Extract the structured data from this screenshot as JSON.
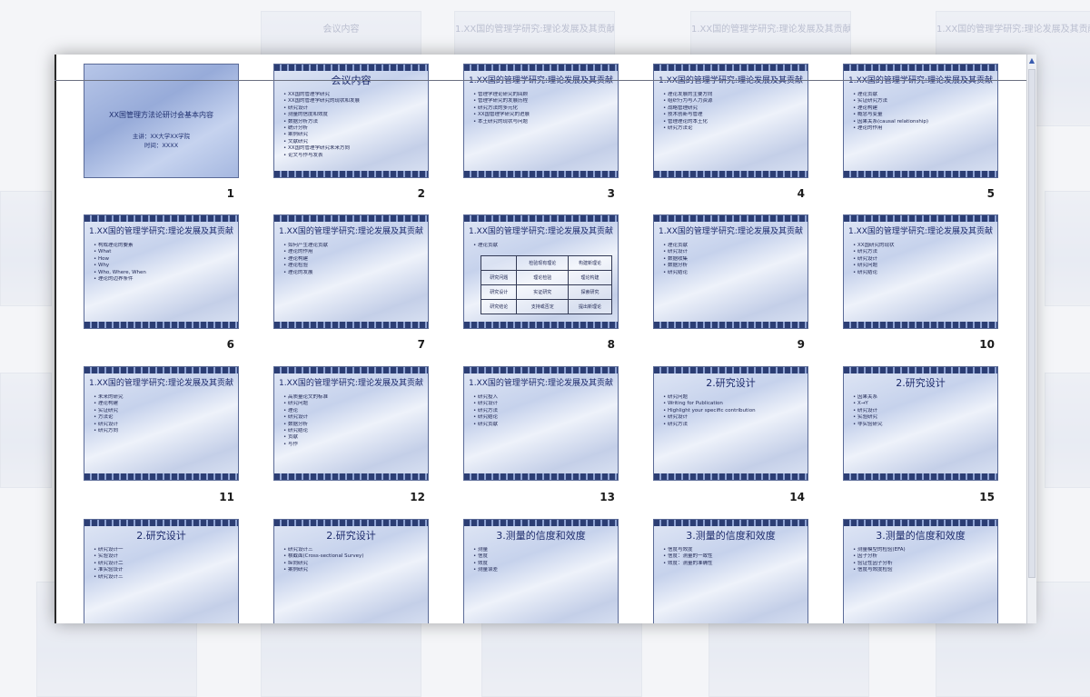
{
  "background_thumbs": [
    {
      "title": "会议内容"
    },
    {
      "title": "1.XX国的管理学研究:理论发展及其贡献"
    },
    {
      "title": "1.XX国的管理学研究:理论发展及其贡献"
    },
    {
      "title": "1.XX国的管理学研究:理论发展及其贡献"
    }
  ],
  "slides": [
    {
      "num": "1",
      "title": "XX国管理方法论研讨会基本内容",
      "cover": true,
      "sub": [
        "主讲：XX大学XX学院",
        "时间：XXXX"
      ],
      "bullets": []
    },
    {
      "num": "2",
      "title": "会议内容",
      "bullets": [
        "XX国的管理学研究",
        "XX国的管理学研究的现状和发展",
        "研究设计",
        "测量的信度和效度",
        "数据分析方法",
        "统计分析",
        "案例研究",
        "文献研究",
        "XX国的管理学研究未来方向",
        "论文写作与发表"
      ]
    },
    {
      "num": "3",
      "title": "1.XX国的管理学研究:理论发展及其贡献",
      "bullets": [
        "管理学理论研究的回顾",
        "管理学研究的发展历程",
        "研究方法的多元化",
        "XX国管理学研究的进展",
        "本土研究的现状与问题"
      ]
    },
    {
      "num": "4",
      "title": "1.XX国的管理学研究:理论发展及其贡献",
      "bullets": [
        "理论发展的主要方向",
        "组织行为与人力资源",
        "战略管理研究",
        "技术创新与管理",
        "管理理论的本土化",
        "研究方法论"
      ]
    },
    {
      "num": "5",
      "title": "1.XX国的管理学研究:理论发展及其贡献",
      "bullets": [
        "理论贡献",
        "实证研究方法",
        "理论构建",
        "概念与变量",
        "因果关系(causal relationship)",
        "理论的作用"
      ]
    },
    {
      "num": "6",
      "title": "1.XX国的管理学研究:理论发展及其贡献",
      "bullets": [
        "构成理论的要素",
        "What",
        "How",
        "Why",
        "Who, Where, When",
        "理论的边界条件"
      ]
    },
    {
      "num": "7",
      "title": "1.XX国的管理学研究:理论发展及其贡献",
      "bullets": [
        "如何产生理论贡献",
        "理论的作用",
        "理论构建",
        "理论检验",
        "理论的发展"
      ]
    },
    {
      "num": "8",
      "title": "1.XX国的管理学研究:理论发展及其贡献",
      "bullets": [
        "理论贡献"
      ],
      "table": [
        [
          "",
          "检验现有理论",
          "构建新理论"
        ],
        [
          "研究问题",
          "理论检验",
          "理论构建"
        ],
        [
          "研究设计",
          "实证研究",
          "探索研究"
        ],
        [
          "研究结论",
          "支持或否定",
          "提出新理论"
        ]
      ]
    },
    {
      "num": "9",
      "title": "1.XX国的管理学研究:理论发展及其贡献",
      "bullets": [
        "理论贡献",
        "研究设计",
        "数据收集",
        "数据分析",
        "研究结论"
      ]
    },
    {
      "num": "10",
      "title": "1.XX国的管理学研究:理论发展及其贡献",
      "bullets": [
        "XX国研究的现状",
        "研究方法",
        "研究设计",
        "研究问题",
        "研究结论"
      ]
    },
    {
      "num": "11",
      "title": "1.XX国的管理学研究:理论发展及其贡献",
      "bullets": [
        "未来的研究",
        "理论构建",
        "实证研究",
        "方法论",
        "研究设计",
        "研究方向"
      ]
    },
    {
      "num": "12",
      "title": "1.XX国的管理学研究:理论发展及其贡献",
      "bullets": [
        "高质量论文的标准",
        "研究问题",
        "理论",
        "研究设计",
        "数据分析",
        "研究结论",
        "贡献",
        "写作"
      ]
    },
    {
      "num": "13",
      "title": "1.XX国的管理学研究:理论发展及其贡献",
      "bullets": [
        "研究投入",
        "研究设计",
        "研究方法",
        "研究结论",
        "研究贡献"
      ]
    },
    {
      "num": "14",
      "title": "2.研究设计",
      "big": true,
      "bullets": [
        "研究问题",
        "Writing for Publication",
        "Highlight your specific contribution",
        "研究设计",
        "研究方法"
      ]
    },
    {
      "num": "15",
      "title": "2.研究设计",
      "big": true,
      "bullets": [
        "因果关系",
        "X→Y",
        "研究设计",
        "实验研究",
        "非实验研究"
      ]
    },
    {
      "num": "",
      "title": "2.研究设计",
      "big": true,
      "bullets": [
        "研究设计一",
        "实验设计",
        "研究设计二",
        "准实验设计",
        "研究设计三"
      ]
    },
    {
      "num": "",
      "title": "2.研究设计",
      "big": true,
      "bullets": [
        "研究设计三",
        "横截面(Cross-sectional Survey)",
        "纵向研究",
        "案例研究"
      ]
    },
    {
      "num": "",
      "title": "3.测量的信度和效度",
      "big": true,
      "bullets": [
        "测量",
        "信度",
        "效度",
        "测量误差"
      ]
    },
    {
      "num": "",
      "title": "3.测量的信度和效度",
      "big": true,
      "bullets": [
        "信度与效度",
        "信度：测量的一致性",
        "效度：测量的准确性"
      ]
    },
    {
      "num": "",
      "title": "3.测量的信度和效度",
      "big": true,
      "bullets": [
        "测量模型的检验(EFA)",
        "因子分析",
        "验证性因子分析",
        "信度与效度检验"
      ]
    }
  ],
  "scroll_up_icon": "▲"
}
